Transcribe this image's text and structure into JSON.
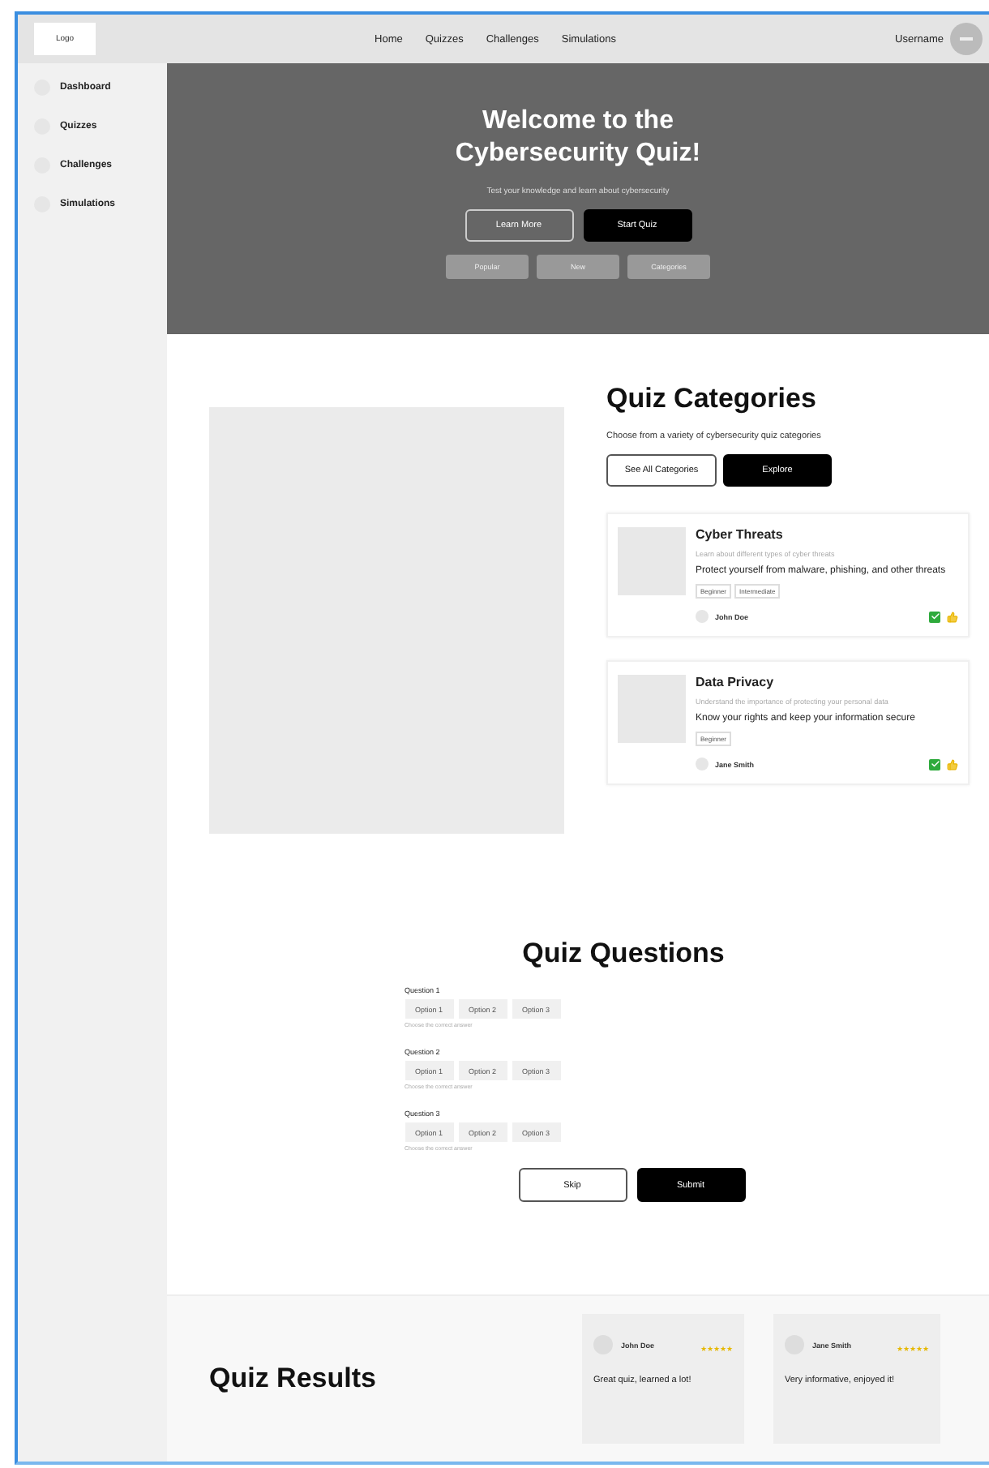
{
  "nav": {
    "logo": "Logo",
    "links": [
      "Home",
      "Quizzes",
      "Challenges",
      "Simulations"
    ],
    "username": "Username"
  },
  "sidebar": {
    "items": [
      {
        "label": "Dashboard"
      },
      {
        "label": "Quizzes"
      },
      {
        "label": "Challenges"
      },
      {
        "label": "Simulations"
      }
    ]
  },
  "hero": {
    "title": "Welcome to the Cybersecurity Quiz!",
    "subtitle": "Test your knowledge and learn about cybersecurity",
    "buttons": [
      {
        "label": "Learn More",
        "kind": "outline"
      },
      {
        "label": "Start Quiz",
        "kind": "solid"
      }
    ],
    "filters": [
      "Popular",
      "New",
      "Categories"
    ]
  },
  "categories": {
    "title": "Quiz Categories",
    "subtitle": "Choose from a variety of cybersecurity quiz categories",
    "buttons": [
      {
        "label": "See All Categories",
        "kind": "outline"
      },
      {
        "label": "Explore",
        "kind": "solid"
      }
    ],
    "cards": [
      {
        "title": "Cyber Threats",
        "caption": "Learn about different types of cyber threats",
        "description": "Protect yourself from malware, phishing, and other threats",
        "tags": [
          "Beginner",
          "Intermediate"
        ],
        "author": "John Doe"
      },
      {
        "title": "Data Privacy",
        "caption": "Understand the importance of protecting your personal data",
        "description": "Know your rights and keep your information secure",
        "tags": [
          "Beginner"
        ],
        "author": "Jane Smith"
      }
    ]
  },
  "questions": {
    "title": "Quiz Questions",
    "items": [
      {
        "label": "Question 1",
        "options": [
          "Option 1",
          "Option 2",
          "Option 3"
        ],
        "hint": "Choose the correct answer"
      },
      {
        "label": "Question 2",
        "options": [
          "Option 1",
          "Option 2",
          "Option 3"
        ],
        "hint": "Choose the correct answer"
      },
      {
        "label": "Question 3",
        "options": [
          "Option 1",
          "Option 2",
          "Option 3"
        ],
        "hint": "Choose the correct answer"
      }
    ],
    "buttons": [
      {
        "label": "Skip",
        "kind": "outline"
      },
      {
        "label": "Submit",
        "kind": "solid"
      }
    ]
  },
  "results": {
    "title": "Quiz Results",
    "reviews": [
      {
        "name": "John Doe",
        "stars": 5,
        "comment": "Great quiz, learned a lot!"
      },
      {
        "name": "Jane Smith",
        "stars": 5,
        "comment": "Very informative, enjoyed it!"
      }
    ]
  }
}
